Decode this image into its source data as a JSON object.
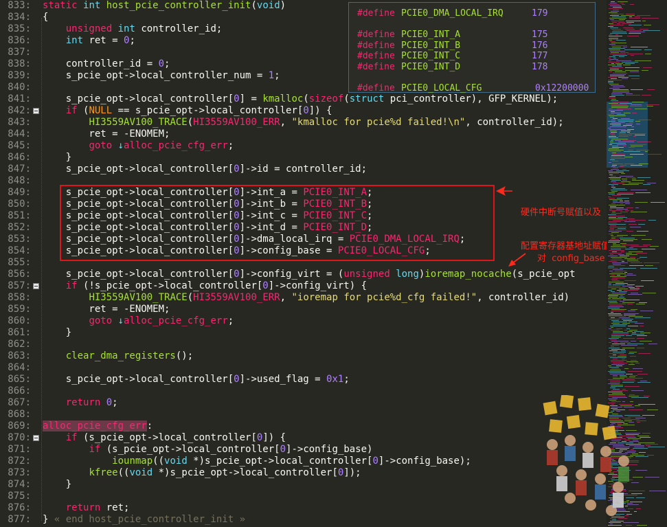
{
  "editor": {
    "lines": [
      {
        "n": "833:",
        "fold": false,
        "segs": [
          [
            "kw",
            "static"
          ],
          [
            "",
            " "
          ],
          [
            "ty",
            "int"
          ],
          [
            "",
            " "
          ],
          [
            "fn",
            "host_pcie_controller_init"
          ],
          [
            "",
            "("
          ],
          [
            "ty",
            "void"
          ],
          [
            "",
            ")"
          ]
        ]
      },
      {
        "n": "834:",
        "fold": false,
        "segs": [
          [
            "",
            "{"
          ]
        ]
      },
      {
        "n": "835:",
        "fold": false,
        "segs": [
          [
            "",
            "    "
          ],
          [
            "kw",
            "unsigned"
          ],
          [
            "",
            " "
          ],
          [
            "ty",
            "int"
          ],
          [
            "",
            " controller_id;"
          ]
        ]
      },
      {
        "n": "836:",
        "fold": false,
        "segs": [
          [
            "",
            "    "
          ],
          [
            "ty",
            "int"
          ],
          [
            "",
            " ret = "
          ],
          [
            "num",
            "0"
          ],
          [
            "",
            ";"
          ]
        ]
      },
      {
        "n": "837:",
        "fold": false,
        "segs": []
      },
      {
        "n": "838:",
        "fold": false,
        "segs": [
          [
            "",
            "    controller_id = "
          ],
          [
            "num",
            "0"
          ],
          [
            "",
            ";"
          ]
        ]
      },
      {
        "n": "839:",
        "fold": false,
        "segs": [
          [
            "",
            "    s_pcie_opt->local_controller_num = "
          ],
          [
            "num",
            "1"
          ],
          [
            "",
            ";"
          ]
        ]
      },
      {
        "n": "840:",
        "fold": false,
        "segs": []
      },
      {
        "n": "841:",
        "fold": false,
        "segs": [
          [
            "",
            "    s_pcie_opt->local_controller["
          ],
          [
            "num",
            "0"
          ],
          [
            "",
            "] = "
          ],
          [
            "fn",
            "kmalloc"
          ],
          [
            "",
            "("
          ],
          [
            "kw",
            "sizeof"
          ],
          [
            "",
            "("
          ],
          [
            "ty",
            "struct"
          ],
          [
            "",
            " pci_controller), GFP_KERNEL);"
          ]
        ]
      },
      {
        "n": "842:",
        "fold": true,
        "segs": [
          [
            "",
            "    "
          ],
          [
            "kw",
            "if"
          ],
          [
            "",
            " ("
          ],
          [
            "mac",
            "NULL"
          ],
          [
            "",
            " == s_pcie_opt->local_controller["
          ],
          [
            "num",
            "0"
          ],
          [
            "",
            "]) {"
          ]
        ]
      },
      {
        "n": "843:",
        "fold": false,
        "segs": [
          [
            "",
            "        "
          ],
          [
            "fn",
            "HI3559AV100_TRACE"
          ],
          [
            "",
            "("
          ],
          [
            "kw",
            "HI3559AV100_ERR"
          ],
          [
            "",
            ", "
          ],
          [
            "str",
            "\"kmalloc for pcie%d failed!\\n\""
          ],
          [
            "",
            ", controller_id);"
          ]
        ]
      },
      {
        "n": "844:",
        "fold": false,
        "segs": [
          [
            "",
            "        ret = -ENOMEM;"
          ]
        ]
      },
      {
        "n": "845:",
        "fold": false,
        "segs": [
          [
            "",
            "        "
          ],
          [
            "kw",
            "goto"
          ],
          [
            "",
            " "
          ],
          [
            "ty",
            "↓"
          ],
          [
            "kw",
            "alloc_pcie_cfg_err"
          ],
          [
            "",
            ";"
          ]
        ]
      },
      {
        "n": "846:",
        "fold": false,
        "segs": [
          [
            "",
            "    }"
          ]
        ]
      },
      {
        "n": "847:",
        "fold": false,
        "segs": [
          [
            "",
            "    s_pcie_opt->local_controller["
          ],
          [
            "num",
            "0"
          ],
          [
            "",
            "]->id = controller_id;"
          ]
        ]
      },
      {
        "n": "848:",
        "fold": false,
        "segs": []
      },
      {
        "n": "849:",
        "fold": false,
        "segs": [
          [
            "",
            "    s_pcie_opt->local_controller["
          ],
          [
            "num",
            "0"
          ],
          [
            "",
            "]->int_a = "
          ],
          [
            "kw",
            "PCIE0_INT_A"
          ],
          [
            "",
            ";"
          ]
        ]
      },
      {
        "n": "850:",
        "fold": false,
        "segs": [
          [
            "",
            "    s_pcie_opt->local_controller["
          ],
          [
            "num",
            "0"
          ],
          [
            "",
            "]->int_b = "
          ],
          [
            "kw",
            "PCIE0_INT_B"
          ],
          [
            "",
            ";"
          ]
        ]
      },
      {
        "n": "851:",
        "fold": false,
        "segs": [
          [
            "",
            "    s_pcie_opt->local_controller["
          ],
          [
            "num",
            "0"
          ],
          [
            "",
            "]->int_c = "
          ],
          [
            "kw",
            "PCIE0_INT_C"
          ],
          [
            "",
            ";"
          ]
        ]
      },
      {
        "n": "852:",
        "fold": false,
        "segs": [
          [
            "",
            "    s_pcie_opt->local_controller["
          ],
          [
            "num",
            "0"
          ],
          [
            "",
            "]->int_d = "
          ],
          [
            "kw",
            "PCIE0_INT_D"
          ],
          [
            "",
            ";"
          ]
        ]
      },
      {
        "n": "853:",
        "fold": false,
        "segs": [
          [
            "",
            "    s_pcie_opt->local_controller["
          ],
          [
            "num",
            "0"
          ],
          [
            "",
            "]->dma_local_irq = "
          ],
          [
            "kw",
            "PCIE0_DMA_LOCAL_IRQ"
          ],
          [
            "",
            ";"
          ]
        ]
      },
      {
        "n": "854:",
        "fold": false,
        "segs": [
          [
            "",
            "    s_pcie_opt->local_controller["
          ],
          [
            "num",
            "0"
          ],
          [
            "",
            "]->config_base = "
          ],
          [
            "kw",
            "PCIE0_LOCAL_CFG"
          ],
          [
            "",
            ";"
          ]
        ]
      },
      {
        "n": "855:",
        "fold": false,
        "segs": []
      },
      {
        "n": "856:",
        "fold": false,
        "segs": [
          [
            "",
            "    s_pcie_opt->local_controller["
          ],
          [
            "num",
            "0"
          ],
          [
            "",
            "]->config_virt = ("
          ],
          [
            "kw",
            "unsigned"
          ],
          [
            "",
            " "
          ],
          [
            "ty",
            "long"
          ],
          [
            "",
            ")"
          ],
          [
            "fn",
            "ioremap_nocache"
          ],
          [
            "",
            "(s_pcie_opt"
          ]
        ]
      },
      {
        "n": "857:",
        "fold": true,
        "segs": [
          [
            "",
            "    "
          ],
          [
            "kw",
            "if"
          ],
          [
            "",
            " (!s_pcie_opt->local_controller["
          ],
          [
            "num",
            "0"
          ],
          [
            "",
            "]->config_virt) {"
          ]
        ]
      },
      {
        "n": "858:",
        "fold": false,
        "segs": [
          [
            "",
            "        "
          ],
          [
            "fn",
            "HI3559AV100_TRACE"
          ],
          [
            "",
            "("
          ],
          [
            "kw",
            "HI3559AV100_ERR"
          ],
          [
            "",
            ", "
          ],
          [
            "str",
            "\"ioremap for pcie%d_cfg failed!\""
          ],
          [
            "",
            ", controller_id)"
          ]
        ]
      },
      {
        "n": "859:",
        "fold": false,
        "segs": [
          [
            "",
            "        ret = -ENOMEM;"
          ]
        ]
      },
      {
        "n": "860:",
        "fold": false,
        "segs": [
          [
            "",
            "        "
          ],
          [
            "kw",
            "goto"
          ],
          [
            "",
            " "
          ],
          [
            "ty",
            "↓"
          ],
          [
            "kw",
            "alloc_pcie_cfg_err"
          ],
          [
            "",
            ";"
          ]
        ]
      },
      {
        "n": "861:",
        "fold": false,
        "segs": [
          [
            "",
            "    }"
          ]
        ]
      },
      {
        "n": "862:",
        "fold": false,
        "segs": []
      },
      {
        "n": "863:",
        "fold": false,
        "segs": [
          [
            "",
            "    "
          ],
          [
            "fn",
            "clear_dma_registers"
          ],
          [
            "",
            "();"
          ]
        ]
      },
      {
        "n": "864:",
        "fold": false,
        "segs": []
      },
      {
        "n": "865:",
        "fold": false,
        "segs": [
          [
            "",
            "    s_pcie_opt->local_controller["
          ],
          [
            "num",
            "0"
          ],
          [
            "",
            "]->used_flag = "
          ],
          [
            "num",
            "0x1"
          ],
          [
            "",
            ";"
          ]
        ]
      },
      {
        "n": "866:",
        "fold": false,
        "segs": []
      },
      {
        "n": "867:",
        "fold": false,
        "segs": [
          [
            "",
            "    "
          ],
          [
            "kw",
            "return"
          ],
          [
            "",
            " "
          ],
          [
            "num",
            "0"
          ],
          [
            "",
            ";"
          ]
        ]
      },
      {
        "n": "868:",
        "fold": false,
        "segs": []
      },
      {
        "n": "869:",
        "fold": false,
        "segs": [
          [
            "hlkw",
            "alloc_pcie_cfg_err"
          ],
          [
            "",
            ":"
          ]
        ]
      },
      {
        "n": "870:",
        "fold": true,
        "segs": [
          [
            "",
            "    "
          ],
          [
            "kw",
            "if"
          ],
          [
            "",
            " (s_pcie_opt->local_controller["
          ],
          [
            "num",
            "0"
          ],
          [
            "",
            "]) {"
          ]
        ]
      },
      {
        "n": "871:",
        "fold": false,
        "segs": [
          [
            "",
            "        "
          ],
          [
            "kw",
            "if"
          ],
          [
            "",
            " (s_pcie_opt->local_controller["
          ],
          [
            "num",
            "0"
          ],
          [
            "",
            "]->config_base)"
          ]
        ]
      },
      {
        "n": "872:",
        "fold": false,
        "segs": [
          [
            "",
            "            "
          ],
          [
            "fn",
            "iounmap"
          ],
          [
            "",
            "(("
          ],
          [
            "ty",
            "void"
          ],
          [
            "",
            " *)s_pcie_opt->local_controller["
          ],
          [
            "num",
            "0"
          ],
          [
            "",
            "]->config_base);"
          ]
        ]
      },
      {
        "n": "873:",
        "fold": false,
        "segs": [
          [
            "",
            "        "
          ],
          [
            "fn",
            "kfree"
          ],
          [
            "",
            "(("
          ],
          [
            "ty",
            "void"
          ],
          [
            "",
            " *)s_pcie_opt->local_controller["
          ],
          [
            "num",
            "0"
          ],
          [
            "",
            "]);"
          ]
        ]
      },
      {
        "n": "874:",
        "fold": false,
        "segs": [
          [
            "",
            "    }"
          ]
        ]
      },
      {
        "n": "875:",
        "fold": false,
        "segs": []
      },
      {
        "n": "876:",
        "fold": false,
        "segs": [
          [
            "",
            "    "
          ],
          [
            "kw",
            "return"
          ],
          [
            "",
            " ret;"
          ]
        ]
      },
      {
        "n": "877:",
        "fold": false,
        "segs": [
          [
            "",
            "} "
          ],
          [
            "grey",
            "« end host_pcie_controller_init »"
          ]
        ]
      }
    ]
  },
  "defines": [
    {
      "kw": "#define",
      "name": "PCIE0_DMA_LOCAL_IRQ",
      "value": "179"
    },
    {
      "kw": "",
      "name": "",
      "value": ""
    },
    {
      "kw": "#define",
      "name": "PCIE0_INT_A",
      "value": "175"
    },
    {
      "kw": "#define",
      "name": "PCIE0_INT_B",
      "value": "176"
    },
    {
      "kw": "#define",
      "name": "PCIE0_INT_C",
      "value": "177"
    },
    {
      "kw": "#define",
      "name": "PCIE0_INT_D",
      "value": "178"
    },
    {
      "kw": "",
      "name": "",
      "value": ""
    },
    {
      "kw": "#define",
      "name": "PCIE0_LOCAL_CFG",
      "value": "0x12200000"
    }
  ],
  "annotations": {
    "note1_line1": "硬件中断号赋值以及",
    "note1_line2": "配置寄存器基地址赋值",
    "note2": "对  config_base 映射"
  },
  "colors": {
    "background": "#272822",
    "keyword": "#f92672",
    "type": "#66d9ef",
    "function": "#a6e22e",
    "number": "#ae81ff",
    "string": "#e6db74",
    "annotation": "#ff2a1e"
  }
}
